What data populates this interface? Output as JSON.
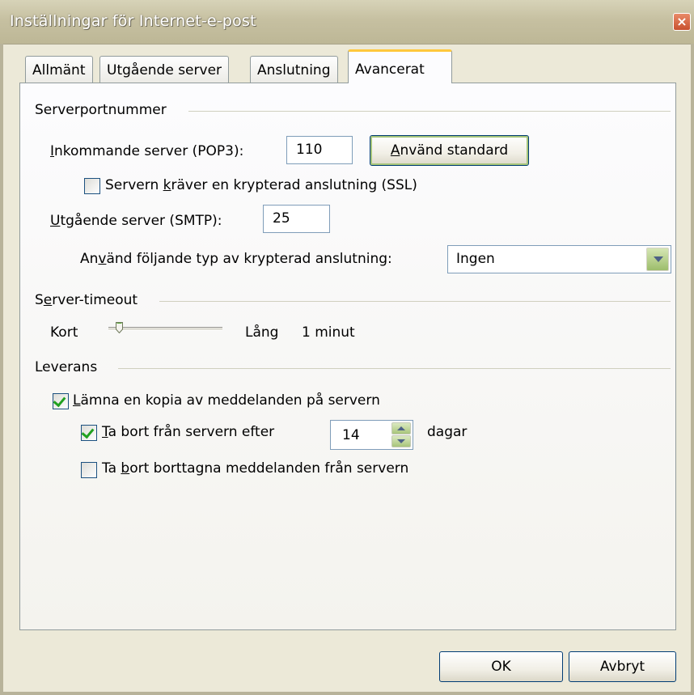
{
  "window": {
    "title": "Inställningar för Internet-e-post",
    "close_label": "×"
  },
  "tabs": [
    {
      "label": "Allmänt",
      "active": false
    },
    {
      "label": "Utgående server",
      "active": false
    },
    {
      "label": "Anslutning",
      "active": false
    },
    {
      "label": "Avancerat",
      "active": true
    }
  ],
  "server_ports": {
    "group_label": "Serverportnummer",
    "incoming": {
      "label_u": "I",
      "label_rest": "nkommande server (POP3):",
      "value": "110"
    },
    "use_default_button": {
      "label_u": "A",
      "label_rest": "nvänd standard"
    },
    "ssl_checkbox": {
      "label_pre": "Servern ",
      "label_u": "k",
      "label_rest": "räver en krypterad anslutning (SSL)",
      "checked": false
    },
    "outgoing": {
      "label_u": "U",
      "label_rest": "tgående server (SMTP):",
      "value": "25"
    },
    "encryption": {
      "label_pre": "An",
      "label_u": "v",
      "label_rest": "änd följande typ av krypterad anslutning:",
      "selected": "Ingen"
    }
  },
  "timeout": {
    "group_label_pre": "S",
    "group_label_u": "e",
    "group_label_rest": "rver-timeout",
    "short_label": "Kort",
    "long_label": "Lång",
    "value_text": "1 minut",
    "slider_level": 0.08
  },
  "delivery": {
    "group_label": "Leverans",
    "leave_copy": {
      "label_u": "L",
      "label_rest": "ämna en kopia av meddelanden på servern",
      "checked": true
    },
    "remove_after": {
      "label_u": "T",
      "label_rest": "a bort från servern efter",
      "checked": true,
      "days": "14",
      "unit": "dagar"
    },
    "remove_deleted": {
      "label_pre": "Ta ",
      "label_u": "b",
      "label_rest": "ort borttagna meddelanden från servern",
      "checked": false
    }
  },
  "footer": {
    "ok_label": "OK",
    "cancel_label": "Avbryt"
  },
  "colors": {
    "accent_tab": "#ffc83c",
    "check_green": "#21a121",
    "close_red": "#c8512f"
  }
}
